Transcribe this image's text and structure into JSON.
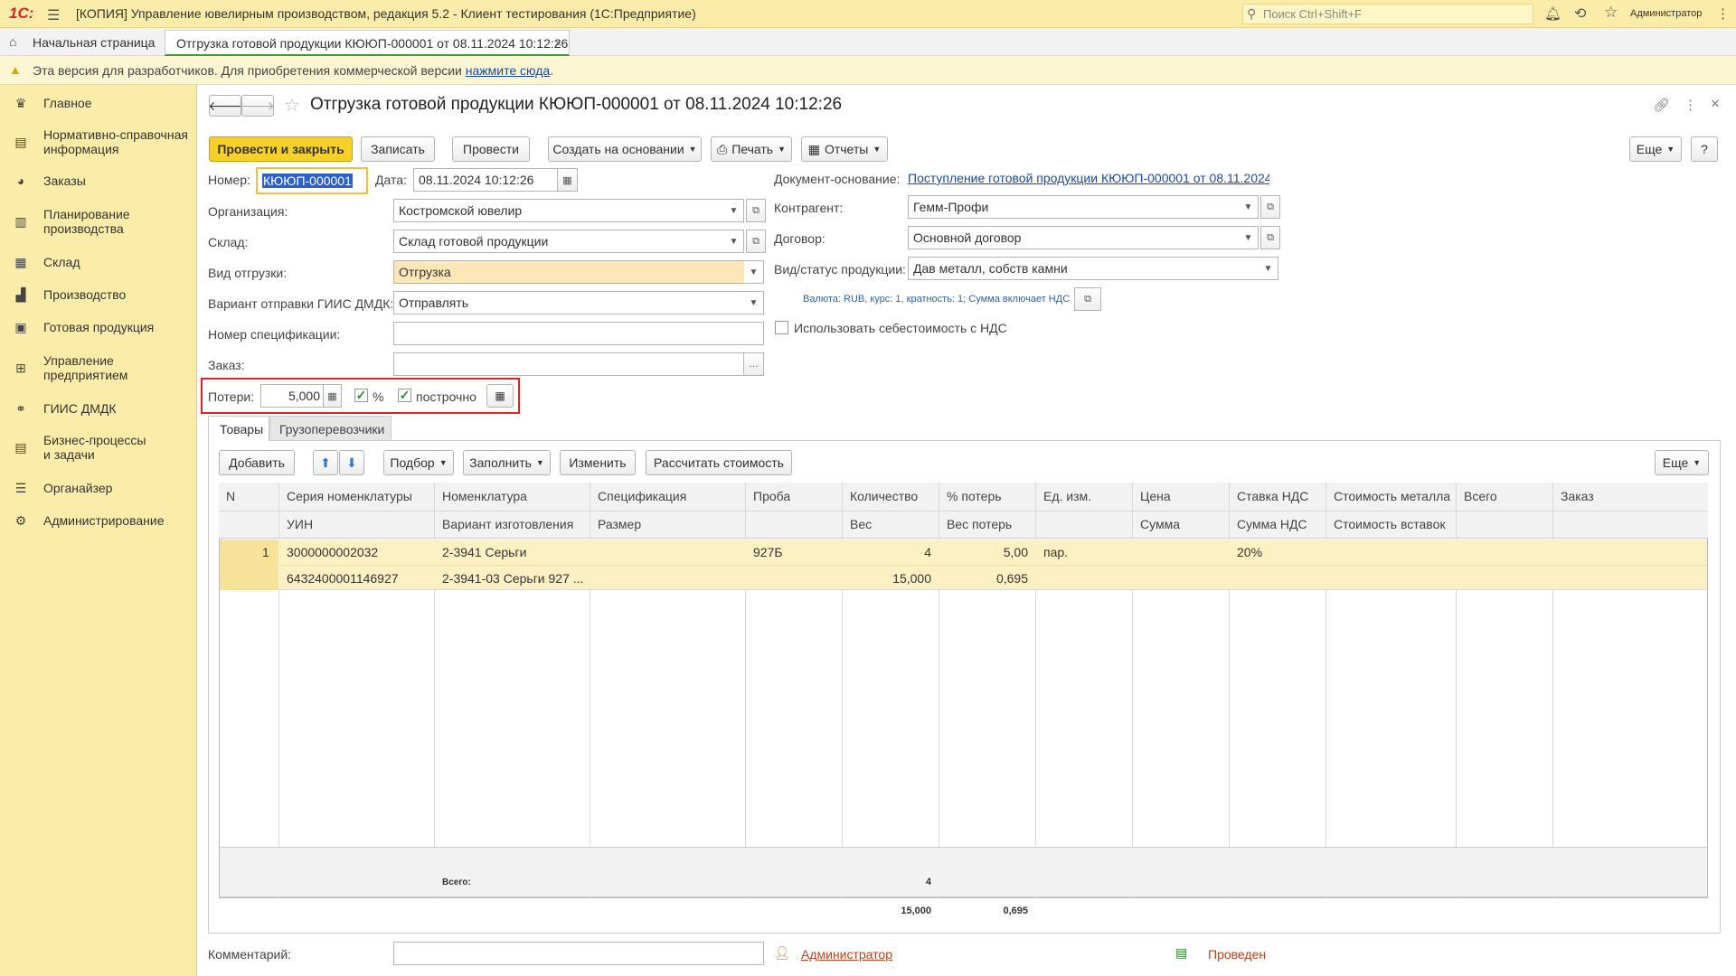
{
  "app": {
    "logo": "1С:",
    "title": "[КОПИЯ] Управление ювелирным производством, редакция 5.2  - Клиент тестирования (1С:Предприятие)",
    "search_placeholder": "Поиск Ctrl+Shift+F",
    "user": "Администратор"
  },
  "tabs": {
    "home": "Начальная страница",
    "doc": "Отгрузка готовой продукции КЮЮП-000001 от 08.11.2024 10:12:26"
  },
  "warning": {
    "text": "Эта версия для разработчиков. Для приобретения коммерческой версии",
    "link": "нажмите сюда",
    "tail": "."
  },
  "sidebar": {
    "items": [
      {
        "label": "Главное",
        "icon": "crown-icon"
      },
      {
        "label": "Нормативно-справочная информация",
        "icon": "books-icon"
      },
      {
        "label": "Заказы",
        "icon": "pie-icon"
      },
      {
        "label": "Планирование производства",
        "icon": "clipboard-icon"
      },
      {
        "label": "Склад",
        "icon": "warehouse-icon"
      },
      {
        "label": "Производство",
        "icon": "factory-icon"
      },
      {
        "label": "Готовая продукция",
        "icon": "box-icon"
      },
      {
        "label": "Управление предприятием",
        "icon": "org-icon"
      },
      {
        "label": "ГИИС ДМДК",
        "icon": "link-icon"
      },
      {
        "label": "Бизнес-процессы и задачи",
        "icon": "tasks-icon"
      },
      {
        "label": "Органайзер",
        "icon": "organizer-icon"
      },
      {
        "label": "Администрирование",
        "icon": "gear-icon"
      }
    ]
  },
  "doc": {
    "title": "Отгрузка готовой продукции КЮЮП-000001 от 08.11.2024 10:12:26",
    "toolbar": {
      "post_close": "Провести и закрыть",
      "save": "Записать",
      "post": "Провести",
      "create_based": "Создать на основании",
      "print": "Печать",
      "reports": "Отчеты",
      "more": "Еще",
      "help": "?"
    },
    "fields": {
      "number_label": "Номер:",
      "number": "КЮЮП-000001",
      "date_label": "Дата:",
      "date": "08.11.2024 10:12:26",
      "org_label": "Организация:",
      "org": "Костромской ювелир",
      "warehouse_label": "Склад:",
      "warehouse": "Склад готовой продукции",
      "shiptype_label": "Вид отгрузки:",
      "shiptype": "Отгрузка",
      "giis_label": "Вариант отправки ГИИС ДМДК:",
      "giis": "Отправлять",
      "spec_label": "Номер спецификации:",
      "spec": "",
      "order_label": "Заказ:",
      "order": "",
      "losses_label": "Потери:",
      "losses": "5,000",
      "percent_label": "%",
      "percent_checked": true,
      "row_label": "построчно",
      "row_checked": true,
      "basis_label": "Документ-основание:",
      "basis": "Поступление готовой продукции КЮЮП-000001 от 08.11.2024...",
      "contractor_label": "Контрагент:",
      "contractor": "Гемм-Профи",
      "contract_label": "Договор:",
      "contract": "Основной договор",
      "status_label": "Вид/статус продукции:",
      "status": "Дав металл, собств камни",
      "currency_info": "Валюта: RUB, курс: 1, кратность: 1; Сумма включает НДС",
      "cost_vat_label": "Использовать себестоимость с НДС"
    },
    "subtabs": [
      "Товары",
      "Грузоперевозчики"
    ],
    "table_toolbar": {
      "add": "Добавить",
      "pick": "Подбор",
      "fill": "Заполнить",
      "edit": "Изменить",
      "calc": "Рассчитать стоимость",
      "more": "Еще"
    },
    "columns_top": [
      "N",
      "Серия номенклатуры",
      "Номенклатура",
      "Спецификация",
      "Проба",
      "Количество",
      "% потерь",
      "Ед. изм.",
      "Цена",
      "Ставка НДС",
      "Стоимость металла",
      "Всего",
      "Заказ"
    ],
    "columns_bottom": [
      "",
      "УИН",
      "Вариант изготовления",
      "Размер",
      "",
      "Вес",
      "Вес потерь",
      "",
      "Сумма",
      "Сумма НДС",
      "Стоимость вставок",
      "",
      ""
    ],
    "rows": [
      {
        "top": [
          "1",
          "3000000002032",
          "2-3941 Серьги",
          "",
          "927Б",
          "4",
          "5,00",
          "пар.",
          "",
          "20%",
          "",
          "",
          ""
        ],
        "bottom": [
          "",
          "6432400001146927",
          "2-3941-03 Серьги 927 ...",
          "",
          "",
          "15,000",
          "0,695",
          "",
          "",
          "",
          "",
          "",
          ""
        ]
      }
    ],
    "totals": {
      "label": "Всего:",
      "qty": "4",
      "weight": "15,000",
      "loss_weight": "0,695"
    },
    "comment_label": "Комментарий:",
    "comment": "",
    "author": "Администратор",
    "status_text": "Проведен"
  },
  "colors": {
    "accent": "#f7d02a",
    "sidebar": "#fbeda9",
    "highlight_box": "#e0201f",
    "row_selected": "#fdf1c4"
  }
}
